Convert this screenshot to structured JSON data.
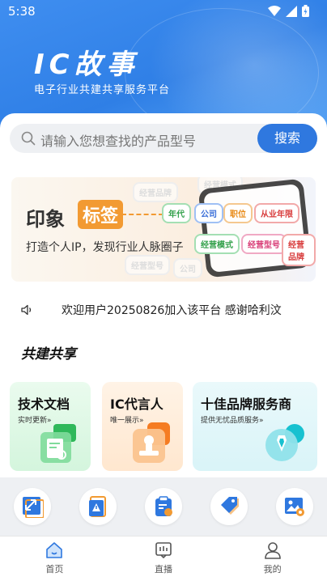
{
  "status_bar": {
    "time": "5:38"
  },
  "header": {
    "logo_title": "IC故事",
    "logo_subtitle": "电子行业共建共享服务平台"
  },
  "search": {
    "placeholder": "请输入您想查找的产品型号",
    "button_label": "搜索"
  },
  "banner": {
    "title": "印象",
    "badge": "标签",
    "subtitle": "打造个人IP，发现行业人脉圈子",
    "tags": [
      "年代",
      "公司",
      "职位",
      "从业年限",
      "经营模式",
      "经营型号",
      "经营品牌"
    ]
  },
  "notice": {
    "text": "欢迎用户20250826加入该平台    感谢哈利汶"
  },
  "section": {
    "title": "共建共享"
  },
  "features": [
    {
      "title": "技术文档",
      "subtitle": "实时更新»"
    },
    {
      "title": "IC代言人",
      "subtitle": "唯一展示»"
    },
    {
      "title": "十佳品牌服务商",
      "subtitle": "提供无忧品质服务»"
    }
  ],
  "quick_icons": [
    "resize-icon",
    "warning-doc-icon",
    "code-clipboard-icon",
    "price-tag-icon",
    "image-settings-icon"
  ],
  "tabbar": [
    {
      "label": "首页",
      "icon": "home-icon",
      "active": true
    },
    {
      "label": "直播",
      "icon": "live-icon",
      "active": false
    },
    {
      "label": "我的",
      "icon": "profile-icon",
      "active": false
    }
  ],
  "colors": {
    "primary": "#2f78df",
    "hero": "#3f8ef0",
    "accent_orange": "#f29a32"
  }
}
